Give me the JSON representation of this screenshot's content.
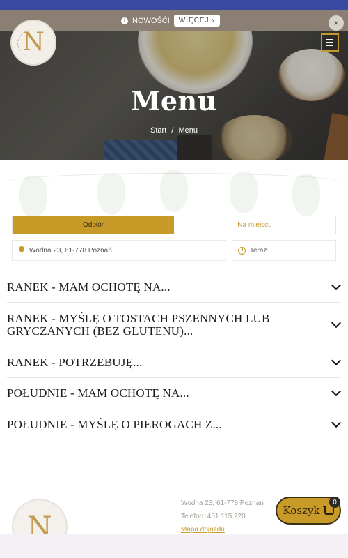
{
  "notice": {
    "text": "NOWOŚĆ!",
    "more_label": "WIĘCEJ ›",
    "close_label": "×"
  },
  "header": {
    "logo_letter": "N"
  },
  "hero": {
    "title": "Menu",
    "breadcrumb": [
      "Start",
      "/",
      "Menu"
    ]
  },
  "order": {
    "tabs": [
      {
        "label": "Odbiór",
        "active": true
      },
      {
        "label": "Na miejscu",
        "active": false
      }
    ],
    "address": "Wodna 23, 61-778 Poznań",
    "time": "Teraz"
  },
  "menu_sections": [
    {
      "label": "RANEK - MAM OCHOTĘ NA..."
    },
    {
      "label": "RANEK - MYŚLĘ O TOSTACH PSZENNYCH LUB GRYCZANYCH (BEZ GLUTENU)..."
    },
    {
      "label": "RANEK - POTRZEBUJĘ..."
    },
    {
      "label": "POŁUDNIE - MAM OCHOTĘ NA..."
    },
    {
      "label": "POŁUDNIE - MYŚLĘ O PIEROGACH Z..."
    }
  ],
  "footer": {
    "address": "Wodna 23, 61-778 Poznań",
    "phone": "Telefon: 451 115 220",
    "map_link": "Mapa dojazdu",
    "logo_letter": "N"
  },
  "cart": {
    "label": "Koszyk",
    "count": "0"
  },
  "colors": {
    "accent": "#c89a28",
    "top_strip": "#3a4aa0",
    "notice_bg": "#8a7f72"
  }
}
